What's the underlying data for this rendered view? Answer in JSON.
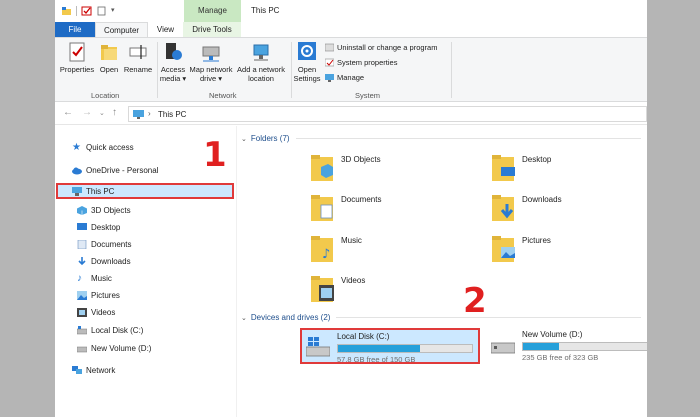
{
  "titlebar": {
    "manage_tab": "Manage",
    "window_title": "This PC"
  },
  "tabs": {
    "file": "File",
    "computer": "Computer",
    "view": "View",
    "drive_tools": "Drive Tools"
  },
  "ribbon": {
    "properties": "Properties",
    "open": "Open",
    "rename": "Rename",
    "location_group": "Location",
    "access_media_1": "Access",
    "access_media_2": "media ▾",
    "map_network_1": "Map network",
    "map_network_2": "drive ▾",
    "add_network_1": "Add a network",
    "add_network_2": "location",
    "network_group": "Network",
    "open_settings_1": "Open",
    "open_settings_2": "Settings",
    "uninstall": "Uninstall or change a program",
    "system_properties": "System properties",
    "manage": "Manage",
    "system_group": "System"
  },
  "address": {
    "path": "This PC"
  },
  "nav": {
    "quick_access": "Quick access",
    "onedrive": "OneDrive - Personal",
    "this_pc": "This PC",
    "objects_3d": "3D Objects",
    "desktop": "Desktop",
    "documents": "Documents",
    "downloads": "Downloads",
    "music": "Music",
    "pictures": "Pictures",
    "videos": "Videos",
    "local_disk": "Local Disk (C:)",
    "new_volume": "New Volume (D:)",
    "network": "Network"
  },
  "content": {
    "folders_header": "Folders (7)",
    "folders": [
      "3D Objects",
      "Desktop",
      "Documents",
      "Downloads",
      "Music",
      "Pictures",
      "Videos"
    ],
    "devices_header": "Devices and drives (2)",
    "drives": [
      {
        "name": "Local Disk (C:)",
        "free": "57.8 GB free of 150 GB",
        "used_fraction": 0.61
      },
      {
        "name": "New Volume (D:)",
        "free": "235 GB free of 323 GB",
        "used_fraction": 0.27
      }
    ]
  },
  "markers": {
    "one": "1",
    "two": "2"
  },
  "colors": {
    "file_tab": "#1e6bc5",
    "manage_tab": "#c9e8c2",
    "selection": "#cce8ff",
    "highlight_box": "#e03a3a",
    "drive_bar": "#26a0da",
    "folder_yellow": "#f2c94c"
  }
}
